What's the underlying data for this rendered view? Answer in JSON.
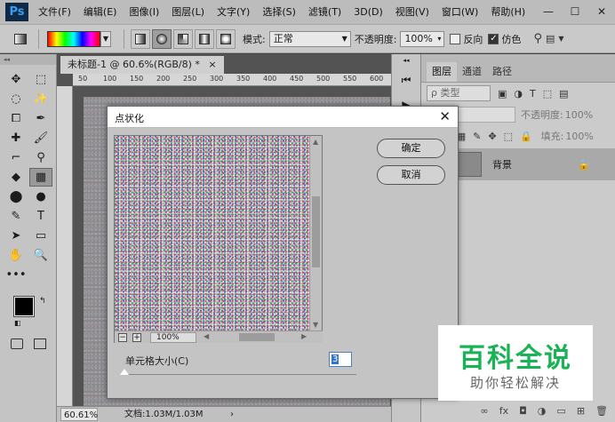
{
  "menubar": {
    "logo": "Ps",
    "items": [
      "文件(F)",
      "编辑(E)",
      "图像(I)",
      "图层(L)",
      "文字(Y)",
      "选择(S)",
      "滤镜(T)",
      "3D(D)",
      "视图(V)",
      "窗口(W)",
      "帮助(H)"
    ],
    "controls": {
      "minimize": "—",
      "maximize": "☐",
      "close": "✕"
    }
  },
  "options": {
    "mode_label": "模式:",
    "mode_value": "正常",
    "opacity_label": "不透明度:",
    "opacity_value": "100%",
    "reverse_label": "反向",
    "dither_label": "仿色",
    "dither_checked": "✓"
  },
  "toolbox": {
    "tools": [
      "✥",
      "⬚",
      "◌",
      "✨",
      "⧠",
      "✒",
      "✚",
      "🖌",
      "⌐",
      "⚲",
      "◆",
      "▦",
      "⬤",
      "●",
      "✎",
      "T",
      "➤",
      "▭",
      "✋",
      "🔍",
      "•••",
      ""
    ]
  },
  "document": {
    "tab_title": "未标题-1 @ 60.6%(RGB/8) *",
    "tab_close": "×",
    "ruler_h": [
      "50",
      "100",
      "150",
      "200",
      "250",
      "300",
      "350",
      "400",
      "450",
      "500",
      "550",
      "600"
    ],
    "zoom": "60.61%",
    "info": "文档:1.03M/1.03M",
    "arrow": "›"
  },
  "layers": {
    "tabs": [
      "图层",
      "通道",
      "路径"
    ],
    "filter_placeholder": "ρ 类型",
    "opacity_label": "不透明度:",
    "opacity_value": "100%",
    "fill_label": "填充:",
    "fill_value": "100%",
    "layer_name": "背景",
    "bottom_icons": [
      "∞",
      "fx",
      "◘",
      "◑",
      "▭",
      "⊞",
      "🗑"
    ]
  },
  "dialog": {
    "title": "点状化",
    "close": "✕",
    "ok_label": "确定",
    "cancel_label": "取消",
    "preview_zoom": "100%",
    "zoom_out": "−",
    "zoom_in": "+",
    "cell_size_label": "单元格大小(C)",
    "cell_size_value": "3"
  },
  "watermark": {
    "title": "百科全说",
    "subtitle": "助你轻松解决"
  }
}
